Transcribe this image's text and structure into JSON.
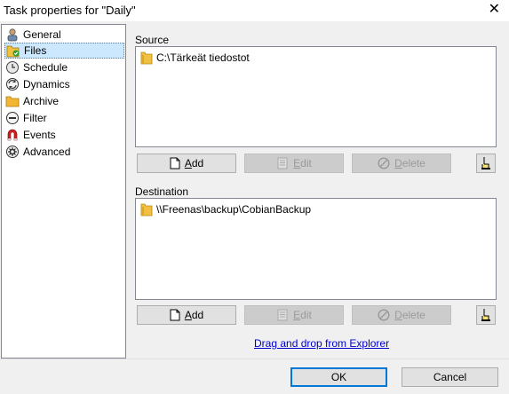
{
  "window": {
    "title": "Task properties for \"Daily\"",
    "close_glyph": "✕"
  },
  "nav": {
    "items": [
      {
        "label": "General",
        "icon": "general-icon",
        "selected": false
      },
      {
        "label": "Files",
        "icon": "files-icon",
        "selected": true
      },
      {
        "label": "Schedule",
        "icon": "schedule-icon",
        "selected": false
      },
      {
        "label": "Dynamics",
        "icon": "dynamics-icon",
        "selected": false
      },
      {
        "label": "Archive",
        "icon": "archive-icon",
        "selected": false
      },
      {
        "label": "Filter",
        "icon": "filter-icon",
        "selected": false
      },
      {
        "label": "Events",
        "icon": "events-icon",
        "selected": false
      },
      {
        "label": "Advanced",
        "icon": "advanced-icon",
        "selected": false
      }
    ]
  },
  "source": {
    "label": "Source",
    "items": [
      "C:\\Tärkeät tiedostot"
    ],
    "buttons": {
      "add": {
        "first": "A",
        "rest": "dd",
        "enabled": true
      },
      "edit": {
        "first": "E",
        "rest": "dit",
        "enabled": false
      },
      "delete": {
        "first": "D",
        "rest": "elete",
        "enabled": false
      }
    }
  },
  "destination": {
    "label": "Destination",
    "items": [
      "\\\\Freenas\\backup\\CobianBackup"
    ],
    "buttons": {
      "add": {
        "first": "A",
        "rest": "dd",
        "enabled": true
      },
      "edit": {
        "first": "E",
        "rest": "dit",
        "enabled": false
      },
      "delete": {
        "first": "D",
        "rest": "elete",
        "enabled": false
      }
    }
  },
  "drag_drop_link": "Drag and drop from Explorer",
  "footer": {
    "ok_label": "OK",
    "cancel_label": "Cancel"
  },
  "colors": {
    "selection": "#cce8ff",
    "link": "#0000cc",
    "accent_border": "#0078d7"
  }
}
